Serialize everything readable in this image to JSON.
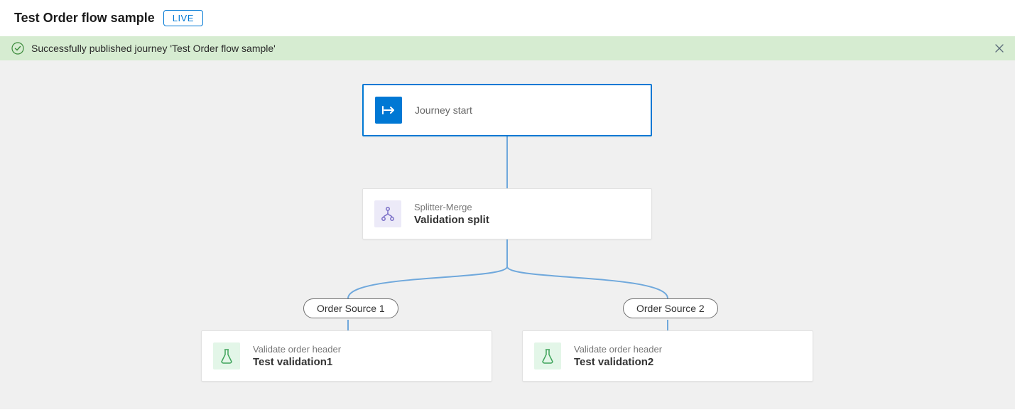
{
  "header": {
    "title": "Test Order flow sample",
    "badge": "LIVE"
  },
  "notification": {
    "message": "Successfully published journey 'Test Order flow sample'"
  },
  "nodes": {
    "start": {
      "label": "Journey start"
    },
    "split": {
      "type": "Splitter-Merge",
      "title": "Validation split"
    },
    "branch1": {
      "label": "Order Source 1"
    },
    "branch2": {
      "label": "Order Source 2"
    },
    "validate1": {
      "type": "Validate order header",
      "title": "Test validation1"
    },
    "validate2": {
      "type": "Validate order header",
      "title": "Test validation2"
    }
  }
}
